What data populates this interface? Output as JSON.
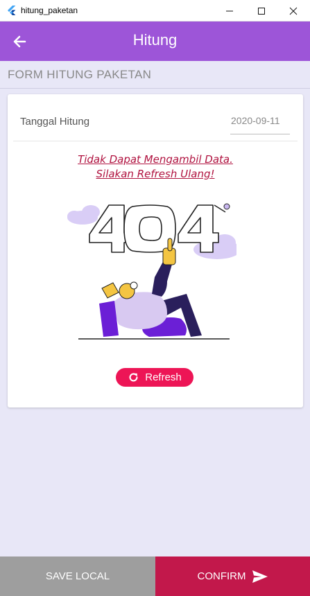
{
  "window": {
    "title": "hitung_paketan",
    "controls": [
      "minimize-icon",
      "maximize-icon",
      "close-icon"
    ]
  },
  "appbar": {
    "title": "Hitung",
    "back_icon": "arrow-left-icon"
  },
  "section": {
    "title": "FORM HITUNG PAKETAN"
  },
  "form": {
    "date_label": "Tanggal Hitung",
    "date_value": "2020-09-11"
  },
  "error": {
    "line1": "Tidak Dapat Mengambil Data.",
    "line2": "Silakan Refresh Ulang!",
    "illustration": "404-illustration"
  },
  "refresh": {
    "label": "Refresh",
    "icon": "refresh-icon"
  },
  "footer": {
    "save_label": "SAVE LOCAL",
    "confirm_label": "CONFIRM",
    "confirm_icon": "send-icon"
  },
  "colors": {
    "appbar": "#9d55d8",
    "background": "#e8e7f7",
    "error_text": "#b0123f",
    "refresh_button": "#ed1556",
    "save_button": "#9e9e9e",
    "confirm_button": "#c2184b"
  }
}
